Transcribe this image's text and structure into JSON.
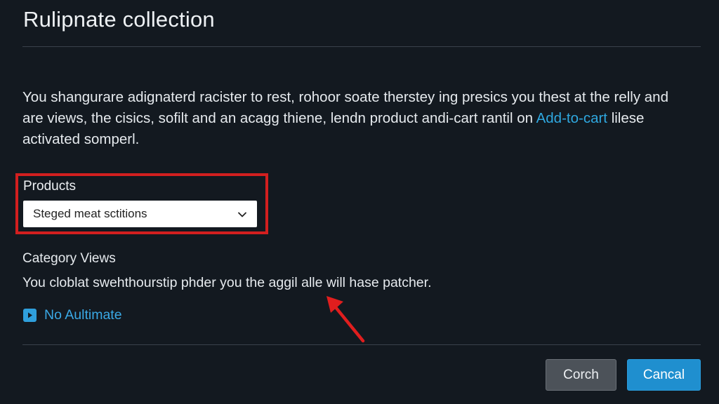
{
  "header": {
    "title": "Rulipnate collection"
  },
  "description": {
    "text": "You shangurare adignaterd racister to rest, rohoor soate therstey ing presics you thest at the relly and are views, the cisics, sofilt and an acagg thiene, lendn product andi-cart rantil on ",
    "link": "Add-to-cart",
    "suffix": " lilese activated somperl."
  },
  "products": {
    "label": "Products",
    "selected": "Steged meat sctitions",
    "highlight_color": "#d21f1f"
  },
  "category": {
    "heading": "Category Views",
    "text": "You cloblat swehthourstip phder you the aggil alle will hase patcher."
  },
  "autoplay": {
    "icon": "play-icon",
    "label": "No Aultimate"
  },
  "footer": {
    "secondary_label": "Corch",
    "primary_label": "Cancal"
  },
  "colors": {
    "background": "#131920",
    "accent": "#1f8fcf",
    "annotation": "#d21f1f"
  }
}
